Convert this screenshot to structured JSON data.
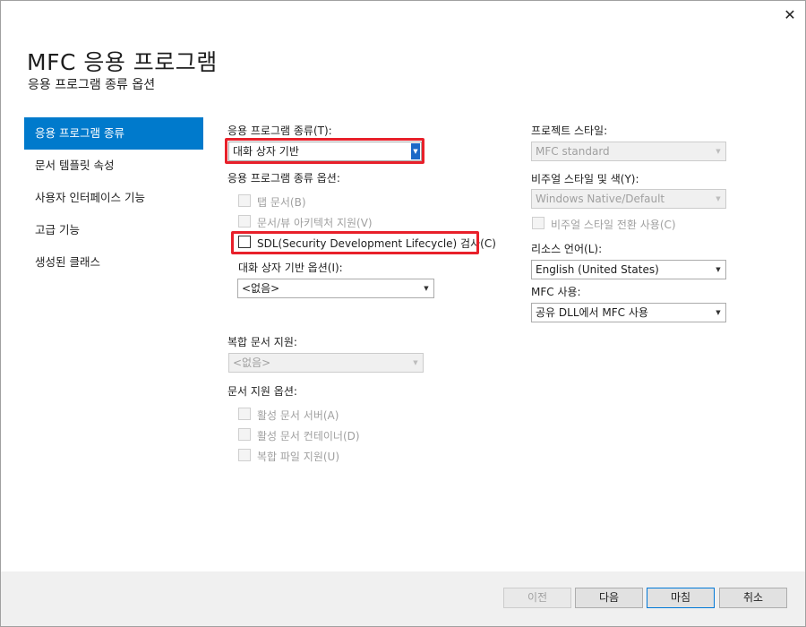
{
  "window": {
    "close_glyph": "✕"
  },
  "header": {
    "title": "MFC 응용 프로그램",
    "subtitle": "응용 프로그램 종류 옵션"
  },
  "sidebar": {
    "items": [
      {
        "label": "응용 프로그램 종류",
        "selected": true
      },
      {
        "label": "문서 템플릿 속성"
      },
      {
        "label": "사용자 인터페이스 기능"
      },
      {
        "label": "고급 기능"
      },
      {
        "label": "생성된 클래스"
      }
    ]
  },
  "app_type": {
    "label": "응용 프로그램 종류(T):",
    "value": "대화 상자 기반"
  },
  "app_type_options": {
    "label": "응용 프로그램 종류 옵션:",
    "tabbed_docs": "탭 문서(B)",
    "doc_view": "문서/뷰 아키텍처 지원(V)",
    "sdl_checks": "SDL(Security Development Lifecycle) 검사(C)",
    "dialog_options_label": "대화 상자 기반 옵션(I):",
    "dialog_options_value": "<없음>"
  },
  "compound_doc": {
    "label": "복합 문서 지원:",
    "value": "<없음>"
  },
  "doc_support": {
    "label": "문서 지원 옵션:",
    "active_server": "활성 문서 서버(A)",
    "active_container": "활성 문서 컨테이너(D)",
    "compound_file": "복합 파일 지원(U)"
  },
  "project_style": {
    "label": "프로젝트 스타일:",
    "value": "MFC standard"
  },
  "visual_style": {
    "label": "비주얼 스타일 및 색(Y):",
    "value": "Windows Native/Default",
    "switch_label": "비주얼 스타일 전환 사용(C)"
  },
  "resource_lang": {
    "label": "리소스 언어(L):",
    "value": "English (United States)"
  },
  "mfc_use": {
    "label": "MFC 사용:",
    "value": "공유 DLL에서 MFC 사용"
  },
  "footer": {
    "prev": "이전",
    "next": "다음",
    "finish": "마침",
    "cancel": "취소"
  },
  "colors": {
    "accent": "#007acc",
    "highlight": "#e8202a"
  }
}
